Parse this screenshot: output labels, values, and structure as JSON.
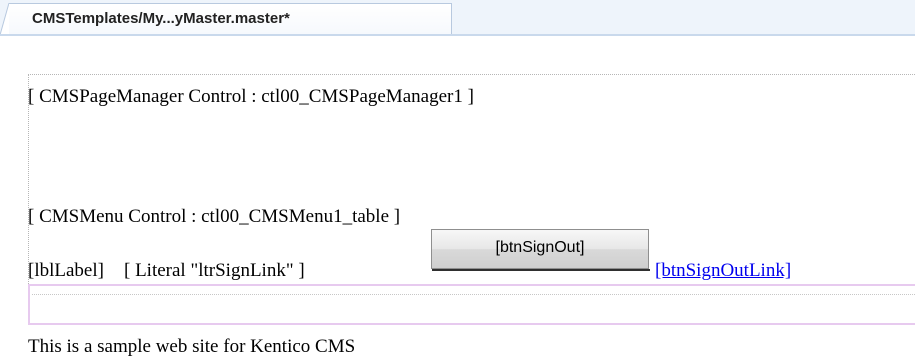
{
  "tab": {
    "title": "CMSTemplates/My...yMaster.master*"
  },
  "design": {
    "page_manager": "[ CMSPageManager Control : ctl00_CMSPageManager1 ]",
    "menu": "[ CMSMenu Control : ctl00_CMSMenu1_table ]",
    "label": "[lblLabel]",
    "literal": "[ Literal \"ltrSignLink\" ]",
    "button": "[btnSignOut]",
    "link": "[btnSignOutLink]",
    "footer_text": "This is a sample web site for Kentico CMS"
  },
  "colors": {
    "link": "#0000ee",
    "tab_border": "#b8c9df",
    "panel_border": "#e7caef"
  }
}
